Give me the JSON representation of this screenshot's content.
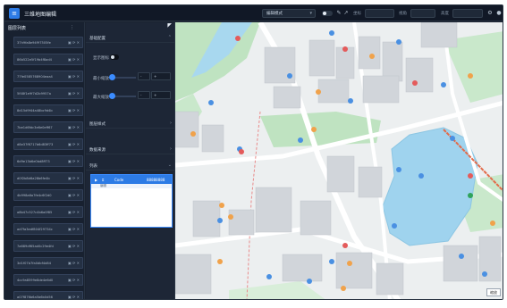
{
  "topbar": {
    "title": "三维地图编辑",
    "dropdown_value": "编辑模式",
    "label_a": "坐标",
    "label_b": "视角",
    "label_c": "高度"
  },
  "left_panel": {
    "title": "图层列表",
    "items": [
      "37h9fa8e94f97505fe",
      "86b522e5f19b4f8ad4",
      "77fe0585768904eaa4",
      "5f48f1e9f7d2b9957a",
      "8d15d9f44a48bc9d4b",
      "7be1d6fdc3e6e0eff67",
      "d8e37f6717b6d83ff73",
      "6d9e13b6e0bd8ff73",
      "d0f2b8d6a28b6fe4b",
      "4b998a6a7fe4c6f2d0",
      "a8b47c527c4b6a0f85",
      "ad7fa3edf804f29734c",
      "7a689df65ad0c29e4fd",
      "3d1f07b7fa0dbf4d84",
      "4cc9a8599e8de4e6d0",
      "a07f876b6a5b6b0d56",
      "f1f05d62b9a4d3d8f8"
    ]
  },
  "mid_panel": {
    "section_basic": "基础配置",
    "show_label": "显示图标",
    "size_label_1": "最小缩放",
    "size_label_2": "最大缩放",
    "section_style": "图层样式",
    "section_data": "数据来源",
    "section_list": "列表",
    "editor_col_1": "Code",
    "editor_col_2": "88888888",
    "editor_sub": "编辑"
  },
  "map": {
    "zoom_label": "缩放"
  }
}
